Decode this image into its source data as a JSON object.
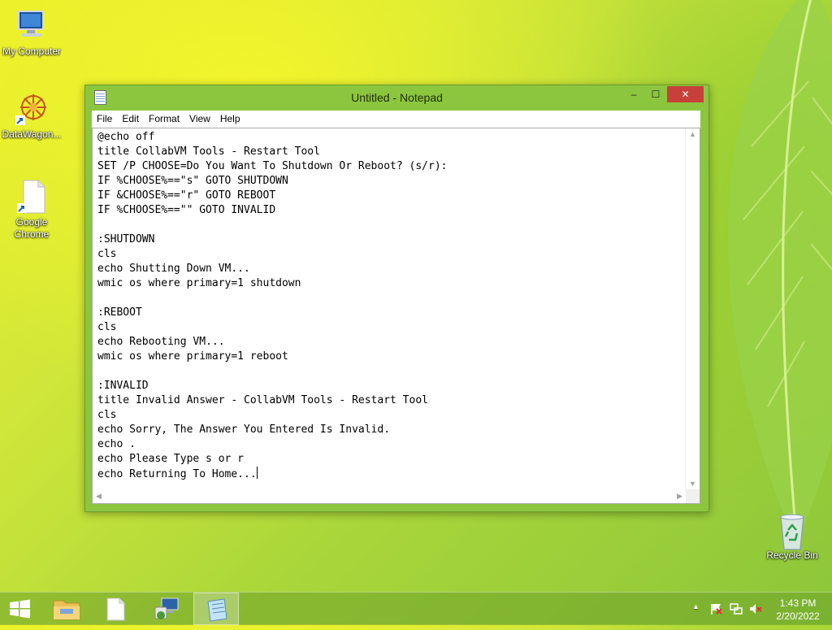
{
  "desktop": {
    "icons": [
      {
        "label": "My Computer"
      },
      {
        "label": "DataWagon..."
      },
      {
        "label": "Google Chrome"
      },
      {
        "label": "Recycle Bin"
      }
    ]
  },
  "window": {
    "title": "Untitled - Notepad",
    "controls": {
      "minimize": "–",
      "maximize": "☐",
      "close": "✕"
    },
    "menu": [
      "File",
      "Edit",
      "Format",
      "View",
      "Help"
    ],
    "content": "@echo off\ntitle CollabVM Tools - Restart Tool\nSET /P CHOOSE=Do You Want To Shutdown Or Reboot? (s/r):\nIF %CHOOSE%==\"s\" GOTO SHUTDOWN\nIF &CHOOSE%==\"r\" GOTO REBOOT\nIF %CHOOSE%==\"\" GOTO INVALID\n\n:SHUTDOWN\ncls\necho Shutting Down VM...\nwmic os where primary=1 shutdown\n\n:REBOOT\ncls\necho Rebooting VM...\nwmic os where primary=1 reboot\n\n:INVALID\ntitle Invalid Answer - CollabVM Tools - Restart Tool\ncls\necho Sorry, The Answer You Entered Is Invalid.\necho .\necho Please Type s or r\necho Returning To Home..."
  },
  "taskbar": {
    "items": [
      "start-button",
      "file-explorer",
      "blank-document",
      "network-tool",
      "notepad"
    ],
    "clock": {
      "time": "1:43 PM",
      "date": "2/20/2022"
    }
  },
  "colors": {
    "window_frame": "#8cc63f",
    "close_button": "#c7403a",
    "taskbar": "#6ea028"
  }
}
